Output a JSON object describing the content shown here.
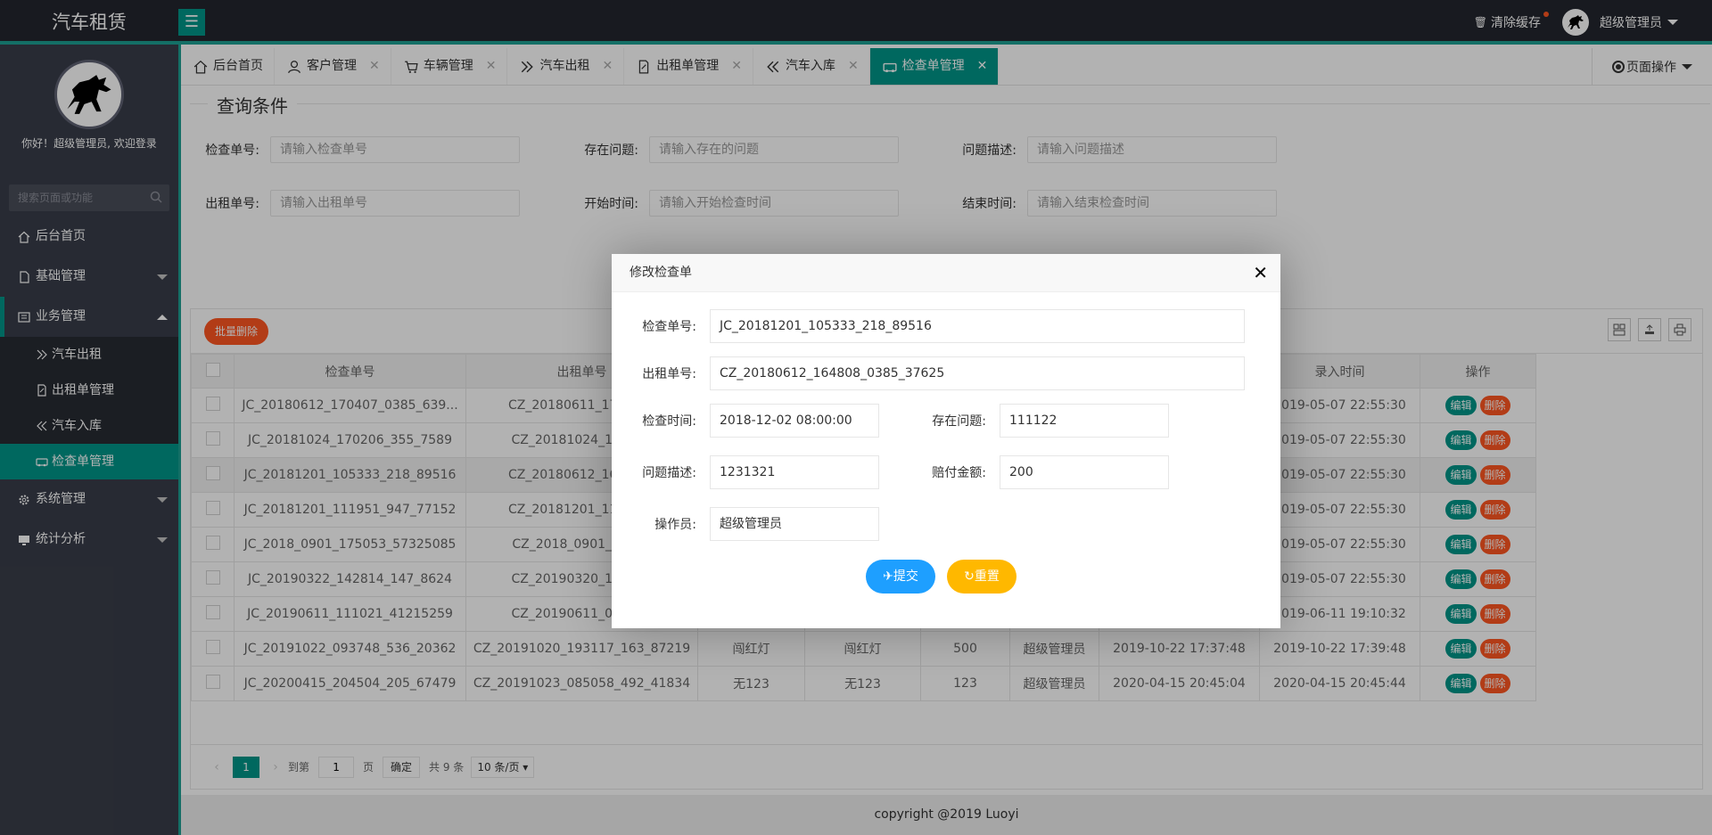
{
  "header": {
    "title": "汽车租赁",
    "clear_cache": "清除缓存",
    "user_name": "超级管理员"
  },
  "sidebar": {
    "welcome": "你好！超级管理员, 欢迎登录",
    "search_placeholder": "搜索页面或功能",
    "items": [
      {
        "label": "后台首页",
        "icon": "home-icon"
      },
      {
        "label": "基础管理",
        "icon": "file-icon"
      },
      {
        "label": "业务管理",
        "icon": "business-icon"
      },
      {
        "label": "系统管理",
        "icon": "gear-icon"
      },
      {
        "label": "统计分析",
        "icon": "monitor-icon"
      }
    ],
    "sub_items": [
      {
        "label": "汽车出租"
      },
      {
        "label": "出租单管理"
      },
      {
        "label": "汽车入库"
      },
      {
        "label": "检查单管理"
      }
    ]
  },
  "tabs": [
    {
      "label": "后台首页"
    },
    {
      "label": "客户管理"
    },
    {
      "label": "车辆管理"
    },
    {
      "label": "汽车出租"
    },
    {
      "label": "出租单管理"
    },
    {
      "label": "汽车入库"
    },
    {
      "label": "检查单管理"
    }
  ],
  "page_op": "页面操作",
  "query": {
    "legend": "查询条件",
    "fields": [
      {
        "label": "检查单号:",
        "placeholder": "请输入检查单号"
      },
      {
        "label": "存在问题:",
        "placeholder": "请输入存在的问题"
      },
      {
        "label": "问题描述:",
        "placeholder": "请输入问题描述"
      },
      {
        "label": "出租单号:",
        "placeholder": "请输入出租单号"
      },
      {
        "label": "开始时间:",
        "placeholder": "请输入开始检查时间"
      },
      {
        "label": "结束时间:",
        "placeholder": "请输入结束检查时间"
      }
    ]
  },
  "table": {
    "batch_delete": "批量删除",
    "headers": {
      "check_no": "检查单号",
      "rent_no": "出租单号",
      "input_time": "录入时间",
      "ops": "操作"
    },
    "edit_label": "编辑",
    "delete_label": "删除",
    "rows": [
      {
        "check_no": "JC_20180612_170407_0385_639...",
        "rent_no": "CZ_20180611_171304_",
        "c3": "",
        "c4": "",
        "c5": "",
        "c6": "",
        "c7": "",
        "input_time": "2019-05-07 22:55:30"
      },
      {
        "check_no": "JC_20181024_170206_355_7589",
        "rent_no": "CZ_20181024_102327",
        "c3": "",
        "c4": "",
        "c5": "",
        "c6": "",
        "c7": "",
        "input_time": "2019-05-07 22:55:30"
      },
      {
        "check_no": "JC_20181201_105333_218_89516",
        "rent_no": "CZ_20180612_164808_",
        "c3": "",
        "c4": "",
        "c5": "",
        "c6": "",
        "c7": "",
        "input_time": "2019-05-07 22:55:30"
      },
      {
        "check_no": "JC_20181201_111951_947_77152",
        "rent_no": "CZ_20181201_111936_",
        "c3": "",
        "c4": "",
        "c5": "",
        "c6": "",
        "c7": "",
        "input_time": "2019-05-07 22:55:30"
      },
      {
        "check_no": "JC_2018_0901_175053_57325085",
        "rent_no": "CZ_2018_0901_17500",
        "c3": "",
        "c4": "",
        "c5": "",
        "c6": "",
        "c7": "",
        "input_time": "2019-05-07 22:55:30"
      },
      {
        "check_no": "JC_20190322_142814_147_8624",
        "rent_no": "CZ_20190320_141553",
        "c3": "",
        "c4": "",
        "c5": "",
        "c6": "",
        "c7": "",
        "input_time": "2019-05-07 22:55:30"
      },
      {
        "check_no": "JC_20190611_111021_41215259",
        "rent_no": "CZ_20190611_094617",
        "c3": "",
        "c4": "",
        "c5": "",
        "c6": "",
        "c7": "",
        "input_time": "2019-06-11 19:10:32"
      },
      {
        "check_no": "JC_20191022_093748_536_20362",
        "rent_no": "CZ_20191020_193117_163_87219",
        "c3": "闯红灯",
        "c4": "闯红灯",
        "c5": "500",
        "c6": "超级管理员",
        "c7": "2019-10-22 17:37:48",
        "input_time": "2019-10-22 17:39:48"
      },
      {
        "check_no": "JC_20200415_204504_205_67479",
        "rent_no": "CZ_20191023_085058_492_41834",
        "c3": "无123",
        "c4": "无123",
        "c5": "123",
        "c6": "超级管理员",
        "c7": "2020-04-15 20:45:04",
        "input_time": "2020-04-15 20:45:44"
      }
    ]
  },
  "pager": {
    "current": "1",
    "goto_label": "到第",
    "goto_value": "1",
    "page_label": "页",
    "confirm": "确定",
    "total": "共 9 条",
    "size": "10 条/页"
  },
  "footer": "copyright @2019 Luoyi",
  "modal": {
    "title": "修改检查单",
    "fields": {
      "check_no_label": "检查单号:",
      "check_no": "JC_20181201_105333_218_89516",
      "rent_no_label": "出租单号:",
      "rent_no": "CZ_20180612_164808_0385_37625",
      "check_time_label": "检查时间:",
      "check_time": "2018-12-02 08:00:00",
      "problem_label": "存在问题:",
      "problem": "111122",
      "desc_label": "问题描述:",
      "desc": "1231321",
      "pay_label": "赔付金额:",
      "pay": "200",
      "operator_label": "操作员:",
      "operator": "超级管理员"
    },
    "submit": "提交",
    "reset": "重置"
  },
  "colors": {
    "accent": "#009688",
    "danger": "#ff5722",
    "submit": "#1e9fff",
    "reset": "#ffb800",
    "sidebar": "#393d49",
    "header": "#23262e"
  }
}
